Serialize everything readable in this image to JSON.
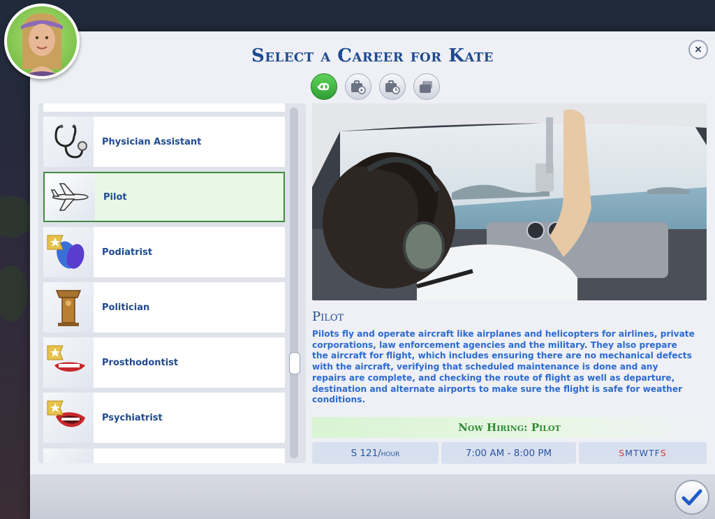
{
  "dialog": {
    "title": "Select a Career for Kate",
    "close_label": "×"
  },
  "filters": [
    {
      "icon": "infinity-icon",
      "active": true
    },
    {
      "icon": "briefcase-play-icon",
      "active": false
    },
    {
      "icon": "briefcase-clock-icon",
      "active": false
    },
    {
      "icon": "briefcase-stack-icon",
      "active": false
    }
  ],
  "careers": [
    {
      "label": "Physician Assistant",
      "icon": "stethoscope-icon"
    },
    {
      "label": "Pilot",
      "icon": "airplane-icon",
      "selected": true
    },
    {
      "label": "Podiatrist",
      "icon": "flip-flops-icon"
    },
    {
      "label": "Politician",
      "icon": "podium-icon"
    },
    {
      "label": "Prosthodontist",
      "icon": "teeth-icon"
    },
    {
      "label": "Psychiatrist",
      "icon": "mouth-icon"
    }
  ],
  "detail": {
    "title": "Pilot",
    "description": "Pilots fly and operate aircraft like airplanes and helicopters for airlines, private corporations, law enforcement agencies and the military. They also prepare the aircraft for flight, which includes ensuring there are no mechanical defects with the aircraft, verifying that scheduled maintenance is done and any repairs are complete, and checking the route of flight as well as departure, destination and alternate airports to make sure the flight is safe for weather conditions.",
    "hiring": "Now Hiring: Pilot",
    "pay": "S 121/hour",
    "hours": "7:00  AM - 8:00  PM",
    "days": [
      "S",
      "M",
      "T",
      "W",
      "T",
      "F",
      "S"
    ]
  },
  "colors": {
    "accent": "#1f4a8f",
    "selected_border": "#3f8a3f",
    "hiring_text": "#2f8a33",
    "weekend": "#d43a3a"
  }
}
